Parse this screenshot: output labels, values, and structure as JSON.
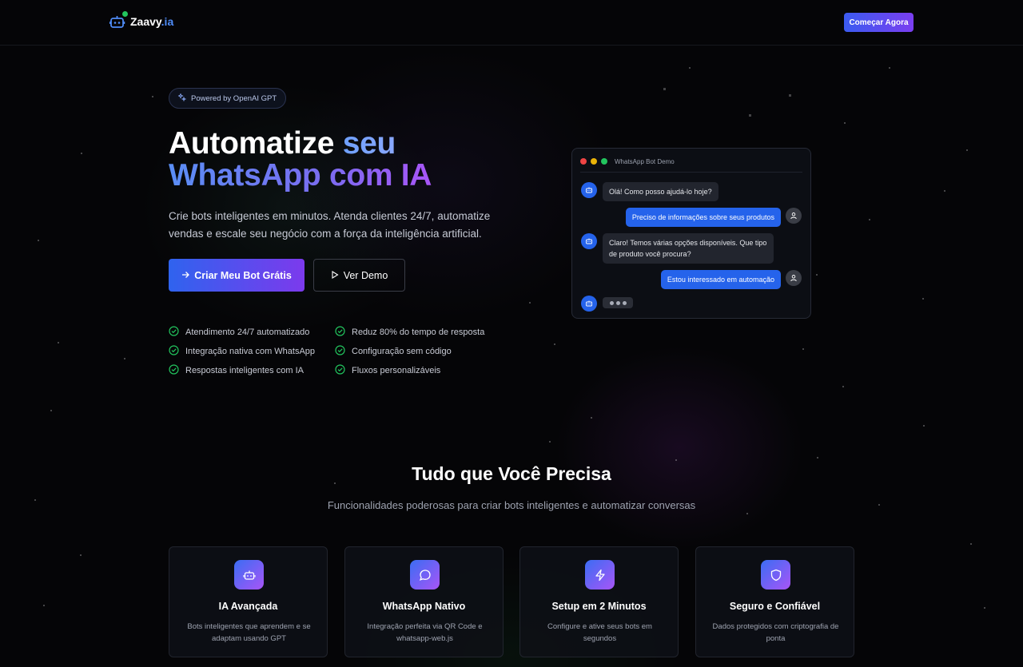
{
  "header": {
    "logo_text": "Zaavy",
    "logo_suffix": ".ia",
    "cta_label": "Começar Agora"
  },
  "hero": {
    "badge_icon": "sparkles-icon",
    "badge_text": "Powered by OpenAI GPT",
    "headline_line1_white": "Automatize ",
    "headline_line1_gradient": "seu",
    "headline_line2": "WhatsApp com IA",
    "subtitle": "Crie bots inteligentes em minutos. Atenda clientes 24/7, automatize vendas e escale seu negócio com a força da inteligência artificial.",
    "primary_button": "Criar Meu Bot Grátis",
    "secondary_button": "Ver Demo",
    "features": [
      "Atendimento 24/7 automatizado",
      "Reduz 80% do tempo de resposta",
      "Integração nativa com WhatsApp",
      "Configuração sem código",
      "Respostas inteligentes com IA",
      "Fluxos personalizáveis"
    ]
  },
  "chat_demo": {
    "title": "WhatsApp Bot Demo",
    "messages": [
      {
        "from": "bot",
        "text": "Olá! Como posso ajudá-lo hoje?"
      },
      {
        "from": "user",
        "text": "Preciso de informações sobre seus produtos"
      },
      {
        "from": "bot",
        "text": "Claro! Temos várias opções disponíveis. Que tipo de produto você procura?"
      },
      {
        "from": "user",
        "text": "Estou interessado em automação"
      }
    ]
  },
  "features_section": {
    "title": "Tudo que Você Precisa",
    "subtitle": "Funcionalidades poderosas para criar bots inteligentes e automatizar conversas",
    "cards": [
      {
        "icon": "bot-icon",
        "title": "IA Avançada",
        "desc": "Bots inteligentes que aprendem e se adaptam usando GPT"
      },
      {
        "icon": "chat-bubble-icon",
        "title": "WhatsApp Nativo",
        "desc": "Integração perfeita via QR Code e whatsapp-web.js"
      },
      {
        "icon": "lightning-icon",
        "title": "Setup em 2 Minutos",
        "desc": "Configure e ative seus bots em segundos"
      },
      {
        "icon": "shield-icon",
        "title": "Seguro e Confiável",
        "desc": "Dados protegidos com criptografia de ponta"
      }
    ]
  },
  "colors": {
    "accent_blue": "#2563eb",
    "accent_purple": "#a855f7",
    "check_green": "#22c55e",
    "background": "#050507"
  }
}
